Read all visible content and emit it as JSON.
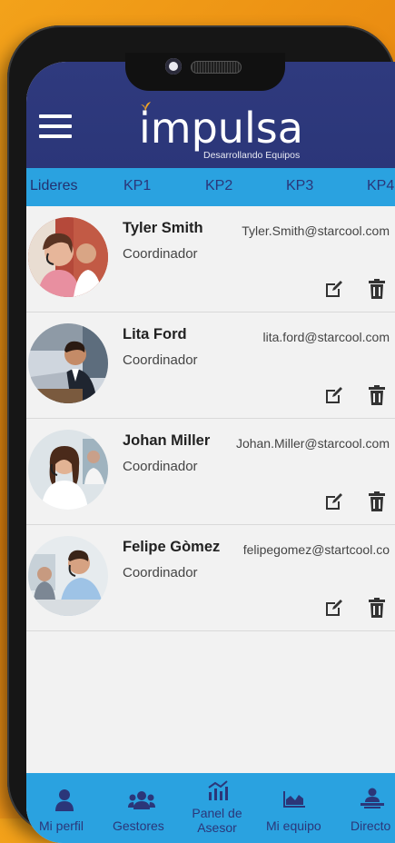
{
  "app": {
    "logo_text": "impulsa",
    "logo_subtitle": "Desarrollando Equipos"
  },
  "tabs": [
    {
      "label": "Lideres",
      "active": true
    },
    {
      "label": "KP1"
    },
    {
      "label": "KP2"
    },
    {
      "label": "KP3"
    },
    {
      "label": "KP4"
    }
  ],
  "contacts": [
    {
      "name": "Tyler Smith",
      "role": "Coordinador",
      "email": "Tyler.Smith@starcool.com",
      "avatar": "agent-headset-woman"
    },
    {
      "name": "Lita Ford",
      "role": "Coordinador",
      "email": "lita.ford@starcool.com",
      "avatar": "businessman-laptop"
    },
    {
      "name": "Johan Miller",
      "role": "Coordinador",
      "email": "Johan.Miller@starcool.com",
      "avatar": "agent-headset-woman-smiling"
    },
    {
      "name": "Felipe Gòmez",
      "role": "Coordinador",
      "email": "felipegomez@startcool.co",
      "avatar": "agent-headset-man"
    }
  ],
  "bottom_nav": [
    {
      "label": "Mi perfil",
      "icon": "user-icon"
    },
    {
      "label": "Gestores",
      "icon": "users-icon"
    },
    {
      "label": "Panel de Asesor",
      "icon": "chart-bars-icon"
    },
    {
      "label": "Mi equipo",
      "icon": "area-chart-icon"
    },
    {
      "label": "Directo",
      "icon": "laptop-user-icon"
    }
  ],
  "colors": {
    "background_orange": "#f0a325",
    "header_navy": "#2f3a7e",
    "accent_blue": "#2aa2e0",
    "text_navy": "#2b3679"
  }
}
